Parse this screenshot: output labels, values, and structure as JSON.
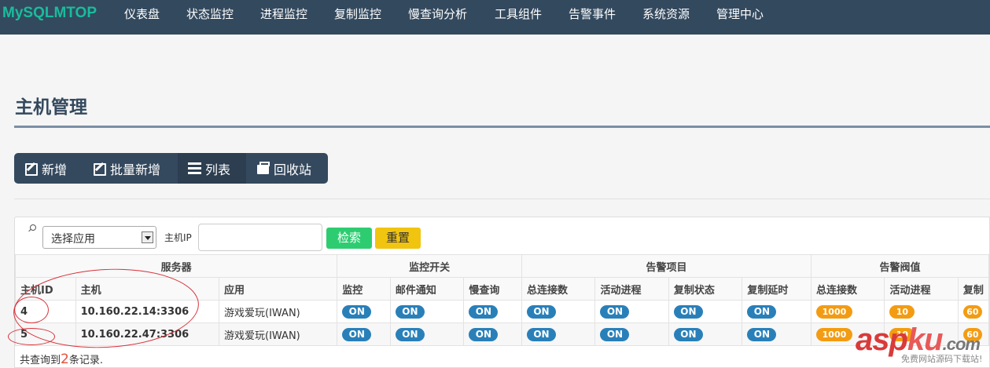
{
  "navbar": {
    "brand": "MySQLMTOP",
    "items": [
      "仪表盘",
      "状态监控",
      "进程监控",
      "复制监控",
      "慢查询分析",
      "工具组件",
      "告警事件",
      "系统资源",
      "管理中心"
    ]
  },
  "page": {
    "title": "主机管理"
  },
  "actions": {
    "add": "新增",
    "batch_add": "批量新增",
    "list": "列表",
    "recycle": "回收站"
  },
  "filter": {
    "app_select": "选择应用",
    "ip_label": "主机IP",
    "ip_value": "",
    "search_button": "检索",
    "reset_button": "重置"
  },
  "table": {
    "groups": [
      "服务器",
      "监控开关",
      "告警项目",
      "告警阀值"
    ],
    "headers": [
      "主机ID",
      "主机",
      "应用",
      "监控",
      "邮件通知",
      "慢查询",
      "总连接数",
      "活动进程",
      "复制状态",
      "复制延时",
      "总连接数",
      "活动进程",
      "复制"
    ],
    "rows": [
      {
        "id": "4",
        "host": "10.160.22.14:3306",
        "app": "游戏爱玩(IWAN)",
        "switches": [
          "ON",
          "ON",
          "ON",
          "ON",
          "ON",
          "ON",
          "ON"
        ],
        "thresholds": [
          "1000",
          "10",
          "60"
        ]
      },
      {
        "id": "5",
        "host": "10.160.22.47:3306",
        "app": "游戏爱玩(IWAN)",
        "switches": [
          "ON",
          "ON",
          "ON",
          "ON",
          "ON",
          "ON",
          "ON"
        ],
        "thresholds": [
          "1000",
          "10",
          "60"
        ]
      }
    ],
    "footer_prefix": "共查询到",
    "footer_count": "2",
    "footer_suffix": "条记录."
  },
  "colors": {
    "navbar": "#33495e",
    "brand": "#1abc9c",
    "on_pill": "#2980b9",
    "threshold_pill": "#f39c12",
    "search_button": "#2ecc71",
    "reset_button": "#f1c40f",
    "annotation": "#d9303a"
  },
  "watermark": {
    "main_a": "asp",
    "main_b": "ku",
    "domain": ".com",
    "sub": "免费网站源码下载站!"
  }
}
